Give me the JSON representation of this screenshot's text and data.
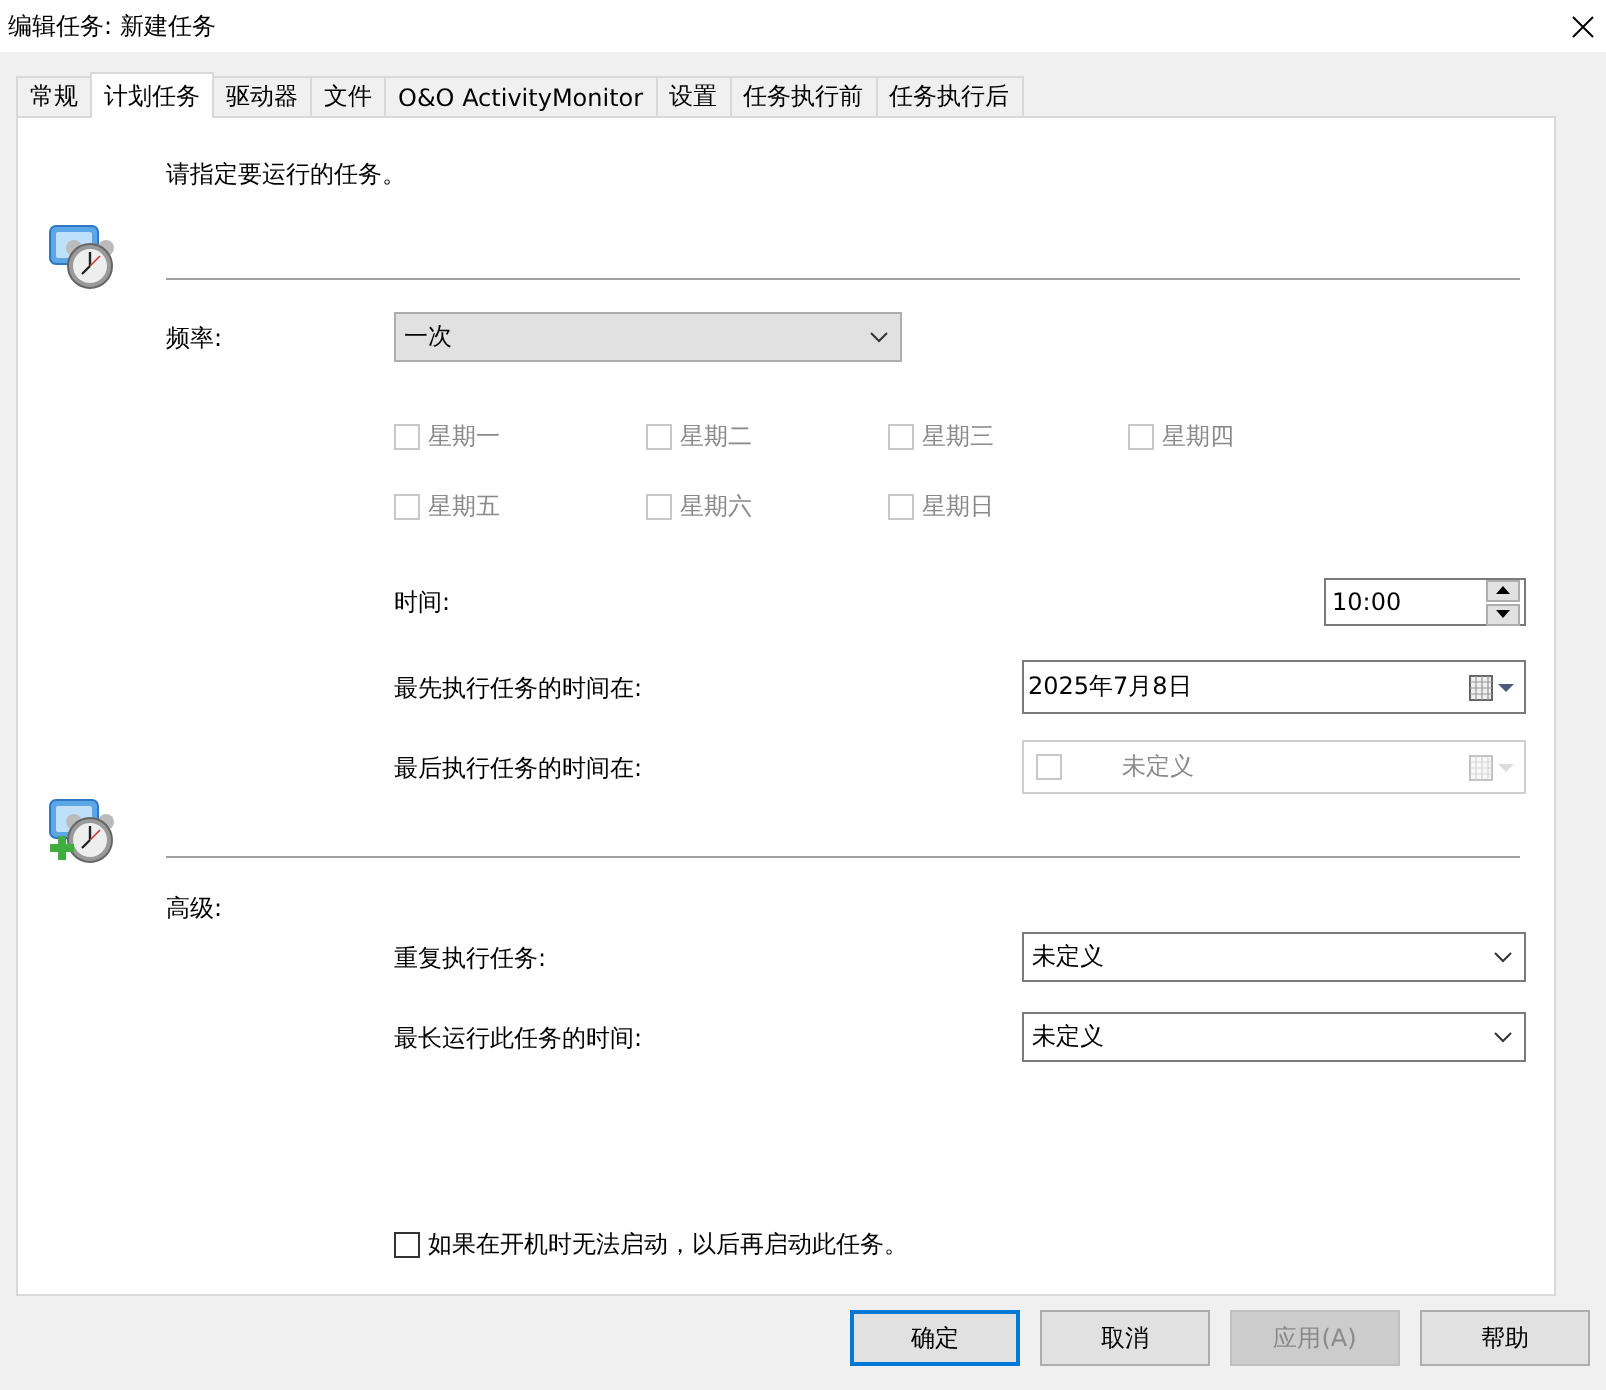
{
  "window": {
    "title": "编辑任务: 新建任务"
  },
  "tabs": [
    {
      "label": "常规",
      "selected": false
    },
    {
      "label": "计划任务",
      "selected": true
    },
    {
      "label": "驱动器",
      "selected": false
    },
    {
      "label": "文件",
      "selected": false
    },
    {
      "label": "O&O ActivityMonitor",
      "selected": false
    },
    {
      "label": "设置",
      "selected": false
    },
    {
      "label": "任务执行前",
      "selected": false
    },
    {
      "label": "任务执行后",
      "selected": false
    }
  ],
  "intro": "请指定要运行的任务。",
  "frequency": {
    "label": "频率:",
    "value": "一次"
  },
  "weekdays": [
    {
      "label": "星期一",
      "checked": false,
      "disabled": true
    },
    {
      "label": "星期二",
      "checked": false,
      "disabled": true
    },
    {
      "label": "星期三",
      "checked": false,
      "disabled": true
    },
    {
      "label": "星期四",
      "checked": false,
      "disabled": true
    },
    {
      "label": "星期五",
      "checked": false,
      "disabled": true
    },
    {
      "label": "星期六",
      "checked": false,
      "disabled": true
    },
    {
      "label": "星期日",
      "checked": false,
      "disabled": true
    }
  ],
  "time": {
    "label": "时间:",
    "value": "10:00"
  },
  "first_run": {
    "label": "最先执行任务的时间在:",
    "value": "2025年7月8日"
  },
  "last_run": {
    "label": "最后执行任务的时间在:",
    "value": "未定义",
    "checked": false,
    "disabled": true
  },
  "advanced": {
    "heading": "高级:",
    "repeat": {
      "label": "重复执行任务:",
      "value": "未定义"
    },
    "max_duration": {
      "label": "最长运行此任务的时间:",
      "value": "未定义"
    }
  },
  "catch_up": {
    "label": "如果在开机时无法启动，以后再启动此任务。",
    "checked": false
  },
  "buttons": [
    {
      "label": "确定",
      "kind": "default",
      "disabled": false
    },
    {
      "label": "取消",
      "kind": "normal",
      "disabled": false
    },
    {
      "label": "应用(A)",
      "kind": "normal",
      "disabled": true
    },
    {
      "label": "帮助",
      "kind": "normal",
      "disabled": false
    }
  ]
}
